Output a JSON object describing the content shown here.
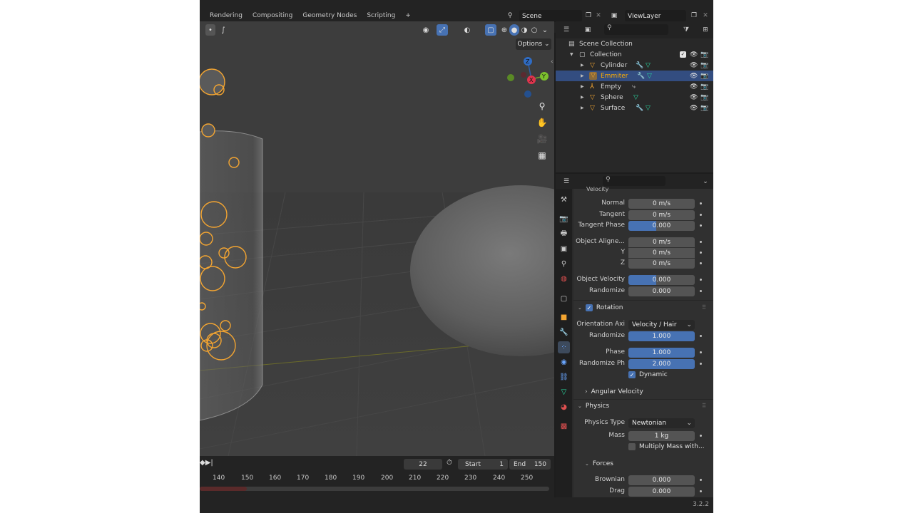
{
  "topbar": {
    "tabs": [
      "Rendering",
      "Compositing",
      "Geometry Nodes",
      "Scripting",
      "+"
    ],
    "scene": "Scene",
    "view_layer": "ViewLayer"
  },
  "viewport": {
    "options_label": "Options",
    "gizmo": {
      "z": "Z",
      "y": "Y",
      "x": "X"
    }
  },
  "timeline": {
    "current_frame": "22",
    "start_label": "Start",
    "start_value": "1",
    "end_label": "End",
    "end_value": "150",
    "ticks": [
      "140",
      "150",
      "160",
      "170",
      "180",
      "190",
      "200",
      "210",
      "220",
      "230",
      "240",
      "250"
    ]
  },
  "outliner": {
    "scene_collection": "Scene Collection",
    "collection": "Collection",
    "items": [
      {
        "name": "Cylinder",
        "selected": false
      },
      {
        "name": "Emmiter",
        "selected": true
      },
      {
        "name": "Empty",
        "selected": false
      },
      {
        "name": "Sphere",
        "selected": false
      },
      {
        "name": "Surface",
        "selected": false
      }
    ]
  },
  "properties": {
    "velocity_partial": "Velocity",
    "normal": {
      "label": "Normal",
      "value": "0 m/s"
    },
    "tangent": {
      "label": "Tangent",
      "value": "0 m/s"
    },
    "tangent_phase": {
      "label": "Tangent Phase",
      "value": "0.000"
    },
    "object_aligned": {
      "label": "Object Aligne...",
      "value": "0 m/s"
    },
    "y": {
      "label": "Y",
      "value": "0 m/s"
    },
    "z": {
      "label": "Z",
      "value": "0 m/s"
    },
    "object_velocity": {
      "label": "Object Velocity",
      "value": "0.000"
    },
    "randomize_vel": {
      "label": "Randomize",
      "value": "0.000"
    },
    "rotation_section": "Rotation",
    "orientation_axis": {
      "label": "Orientation Axi",
      "value": "Velocity / Hair"
    },
    "randomize_rot": {
      "label": "Randomize",
      "value": "1.000"
    },
    "phase": {
      "label": "Phase",
      "value": "1.000"
    },
    "randomize_phase": {
      "label": "Randomize Ph",
      "value": "2.000"
    },
    "dynamic_label": "Dynamic",
    "angular_velocity": "Angular Velocity",
    "physics_section": "Physics",
    "physics_type": {
      "label": "Physics Type",
      "value": "Newtonian"
    },
    "mass": {
      "label": "Mass",
      "value": "1 kg"
    },
    "multiply_mass": "Multiply Mass with...",
    "forces_section": "Forces",
    "brownian": {
      "label": "Brownian",
      "value": "0.000"
    },
    "drag": {
      "label": "Drag",
      "value": "0.000"
    }
  },
  "status": {
    "version": "3.2.2"
  },
  "colors": {
    "accent_blue": "#4772b3",
    "selection": "#334d80",
    "selected_text": "#ffae00",
    "particle_orange": "#f4a531"
  }
}
